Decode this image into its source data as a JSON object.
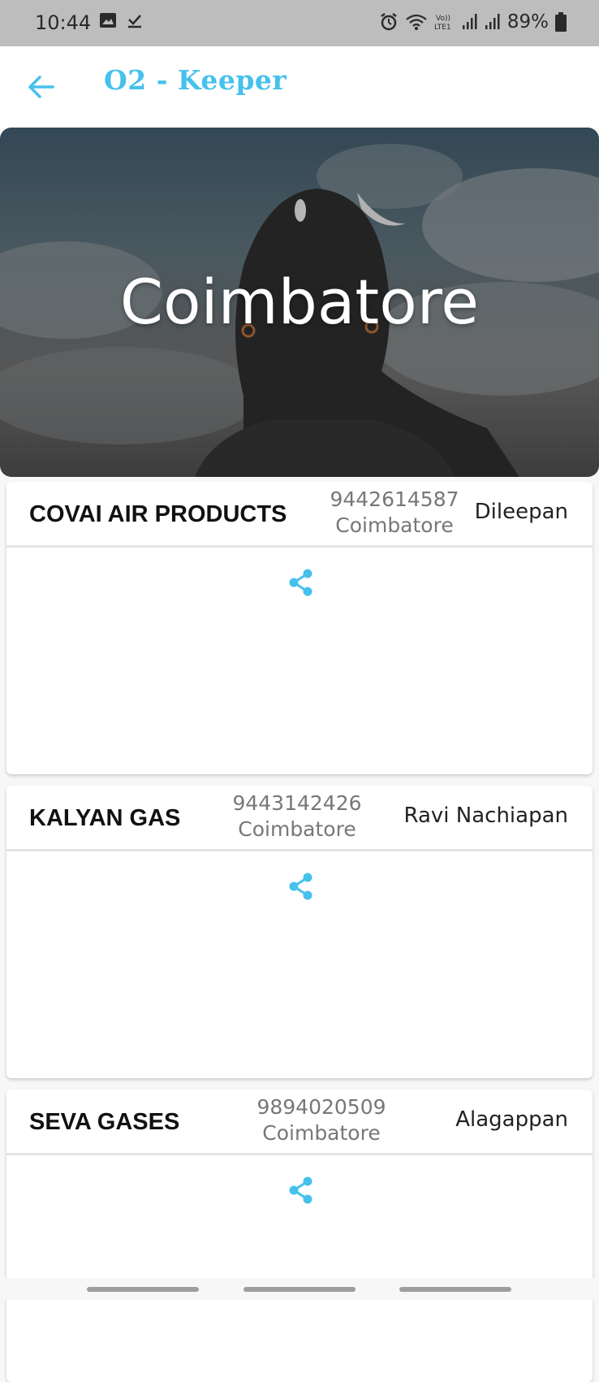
{
  "status_bar": {
    "time": "10:44",
    "battery": "89%",
    "icons": [
      "image-icon",
      "check-download-icon",
      "alarm-icon",
      "wifi-icon",
      "volte-icon",
      "signal-icon",
      "signal-icon-2",
      "battery-icon"
    ],
    "volte_label": "Vo))\nLTE1"
  },
  "app_bar": {
    "title": "O2 - Keeper",
    "back_icon": "arrow-left-icon"
  },
  "hero": {
    "city": "Coimbatore"
  },
  "suppliers": [
    {
      "name": "COVAI AIR PRODUCTS",
      "phone": "9442614587",
      "city": "Coimbatore",
      "contact_person": "Dileepan"
    },
    {
      "name": "KALYAN GAS",
      "phone": "9443142426",
      "city": "Coimbatore",
      "contact_person": "Ravi Nachiapan"
    },
    {
      "name": "SEVA GASES",
      "phone": "9894020509",
      "city": "Coimbatore",
      "contact_person": "Alagappan"
    }
  ],
  "colors": {
    "accent": "#45c1ec",
    "status_bar_bg": "#bdbdbd",
    "card_bg": "#ffffff",
    "page_bg": "#f7f7f7"
  }
}
